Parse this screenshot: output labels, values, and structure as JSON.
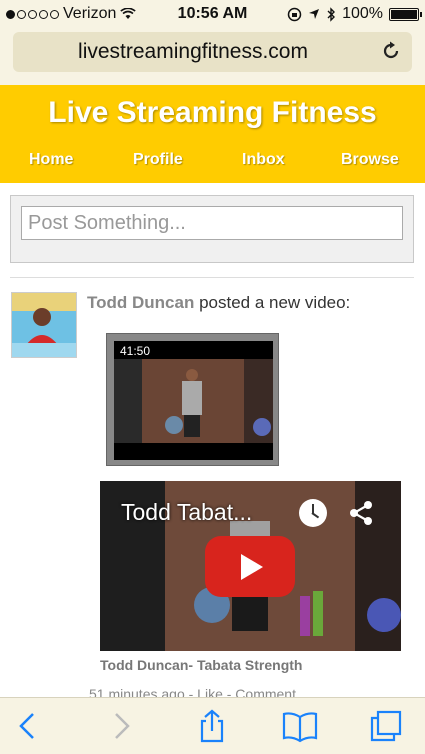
{
  "status_bar": {
    "carrier": "Verizon",
    "time": "10:56 AM",
    "battery": "100%"
  },
  "browser": {
    "url": "livestreamingfitness.com"
  },
  "site": {
    "title": "Live Streaming Fitness",
    "nav": [
      "Home",
      "Profile",
      "Inbox",
      "Browse"
    ]
  },
  "composer": {
    "placeholder": "Post Something..."
  },
  "feed": {
    "user_name": "Todd Duncan",
    "action_text": " posted a new video:",
    "thumb_duration": "41:50",
    "player_title": "Todd Tabat...",
    "video_caption": "Todd Duncan- Tabata Strength",
    "meta": "51 minutes ago - Like - Comment"
  },
  "colors": {
    "header": "#ffcc00",
    "toolbar_icon": "#1a82fb",
    "play_button": "#d8241d"
  },
  "icons": {
    "wifi": "wifi-icon",
    "location": "location-arrow-icon",
    "bluetooth": "bluetooth-icon",
    "reload": "reload-icon",
    "back": "chevron-left-icon",
    "forward": "chevron-right-icon",
    "share": "share-icon",
    "bookmarks": "book-icon",
    "tabs": "tabs-icon"
  }
}
